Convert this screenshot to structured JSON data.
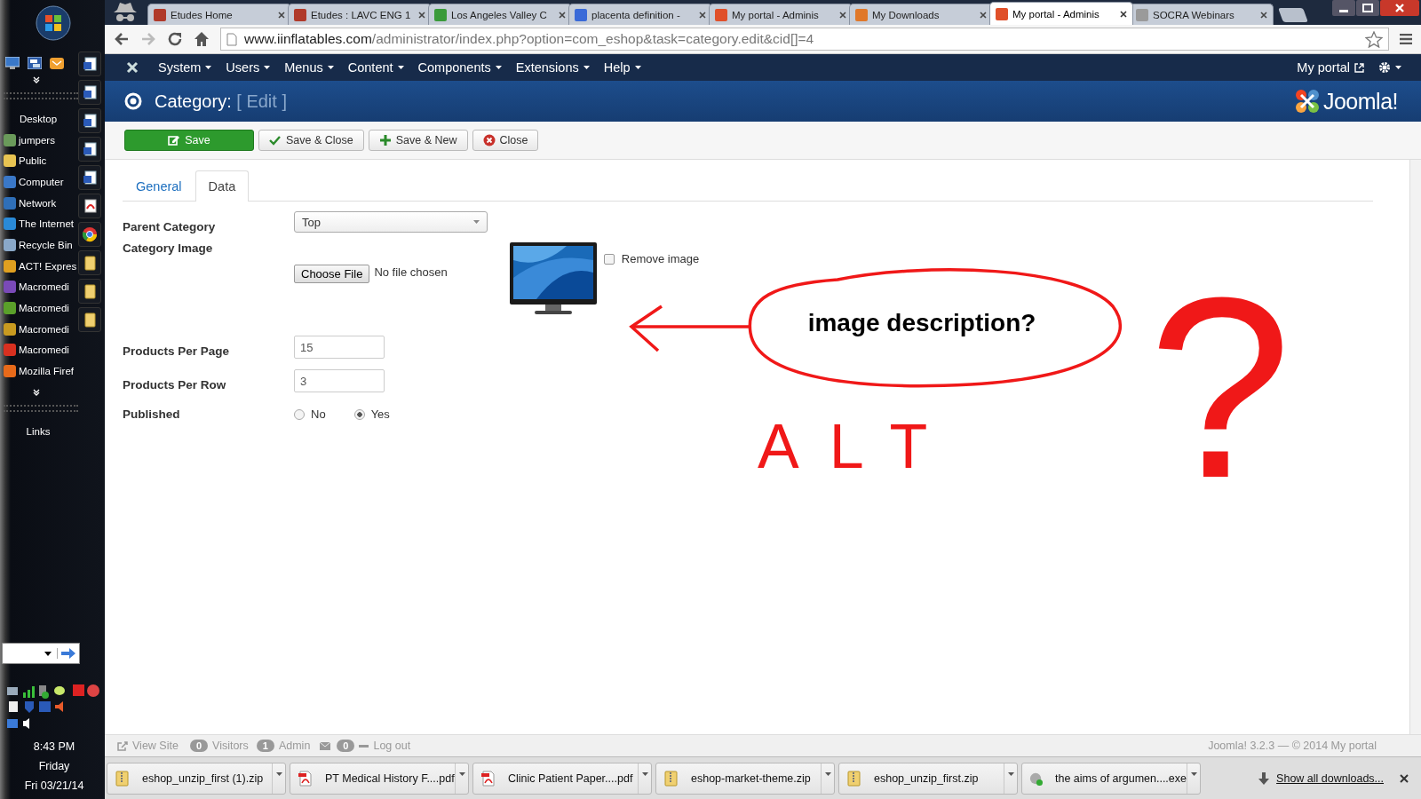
{
  "desktop_sidebar": {
    "items": [
      {
        "label": "Desktop"
      },
      {
        "label": "jumpers",
        "color": "#6a9a5a"
      },
      {
        "label": "Public",
        "color": "#e8c452"
      },
      {
        "label": "Computer",
        "color": "#3a78c8"
      },
      {
        "label": "Network",
        "color": "#2f6fb8"
      },
      {
        "label": "The Internet",
        "color": "#2a8ad8"
      },
      {
        "label": "Recycle Bin",
        "color": "#8aa8c8"
      },
      {
        "label": "ACT! Expres",
        "color": "#e0a020"
      },
      {
        "label": "Macromedi",
        "color": "#7a4ab8"
      },
      {
        "label": "Macromedi",
        "color": "#5aa02a"
      },
      {
        "label": "Macromedi",
        "color": "#c89a20"
      },
      {
        "label": "Macromedi",
        "color": "#d83020"
      },
      {
        "label": "Mozilla Firef",
        "color": "#e86a1a"
      }
    ],
    "links_label": "Links",
    "taskbar_buttons": [
      {
        "kind": "word"
      },
      {
        "kind": "word"
      },
      {
        "kind": "word"
      },
      {
        "kind": "word"
      },
      {
        "kind": "word"
      },
      {
        "kind": "pdf"
      },
      {
        "kind": "chrome"
      },
      {
        "kind": "folder"
      },
      {
        "kind": "folder"
      },
      {
        "kind": "folder"
      }
    ],
    "clock": {
      "time": "8:43 PM",
      "day": "Friday",
      "date": "Fri 03/21/14"
    }
  },
  "browser": {
    "tabs": [
      {
        "title": "Etudes Home",
        "color": "#b03a2a",
        "selected": false
      },
      {
        "title": "Etudes : LAVC ENG 1",
        "color": "#b03a2a",
        "selected": false
      },
      {
        "title": "Los Angeles Valley C",
        "color": "#3a9a3a",
        "selected": false
      },
      {
        "title": "placenta definition -",
        "color": "#3a6ad8",
        "selected": false
      },
      {
        "title": "My portal - Adminis",
        "color": "#e0502a",
        "selected": false
      },
      {
        "title": "My Downloads",
        "color": "#e0782a",
        "selected": false
      },
      {
        "title": "My portal - Adminis",
        "color": "#e0502a",
        "selected": true
      },
      {
        "title": "SOCRA Webinars",
        "color": "#9a9a9a",
        "selected": false
      }
    ],
    "url_host": "www.iinflatables.com",
    "url_path": "/administrator/index.php?option=com_eshop&task=category.edit&cid[]=4"
  },
  "joomla": {
    "menu": [
      "System",
      "Users",
      "Menus",
      "Content",
      "Components",
      "Extensions",
      "Help"
    ],
    "user_menu": "My portal",
    "title": "Category:",
    "subtitle": "[ Edit ]",
    "logo": "Joomla!",
    "toolbar": [
      {
        "label": "Save",
        "kind": "save"
      },
      {
        "label": "Save & Close",
        "kind": "check"
      },
      {
        "label": "Save & New",
        "kind": "new"
      },
      {
        "label": "Close",
        "kind": "close"
      }
    ],
    "tabs": [
      {
        "label": "General",
        "selected": false
      },
      {
        "label": "Data",
        "selected": true
      }
    ],
    "form": {
      "parent_label": "Parent Category",
      "parent_value": "Top",
      "image_label": "Category Image",
      "choose_file": "Choose File",
      "no_file": "No file chosen",
      "remove_image": {
        "label": "Remove image",
        "checked": false
      },
      "per_page_label": "Products Per Page",
      "per_page_value": "15",
      "per_row_label": "Products Per Row",
      "per_row_value": "3",
      "published_label": "Published",
      "published_options": [
        {
          "label": "No",
          "selected": false
        },
        {
          "label": "Yes",
          "selected": true
        }
      ]
    },
    "status": {
      "view_site": "View Site",
      "counters": [
        {
          "count": "0",
          "label": "Visitors"
        },
        {
          "count": "1",
          "label": "Admin"
        }
      ],
      "messages": "0",
      "logout": "Log out",
      "version": "Joomla! 3.2.3  —  © 2014 My portal"
    }
  },
  "annotation": {
    "bubble": "image description?",
    "alt": "ALT",
    "question": "?"
  },
  "downloads": {
    "items": [
      {
        "name": "eshop_unzip_first (1).zip",
        "kind": "zip"
      },
      {
        "name": "PT Medical History F....pdf",
        "kind": "pdf"
      },
      {
        "name": "Clinic Patient Paper....pdf",
        "kind": "pdf"
      },
      {
        "name": "eshop-market-theme.zip",
        "kind": "zip"
      },
      {
        "name": "eshop_unzip_first.zip",
        "kind": "zip"
      },
      {
        "name": "the aims of argumen....exe",
        "kind": "exe"
      }
    ],
    "show_all": "Show all downloads..."
  }
}
